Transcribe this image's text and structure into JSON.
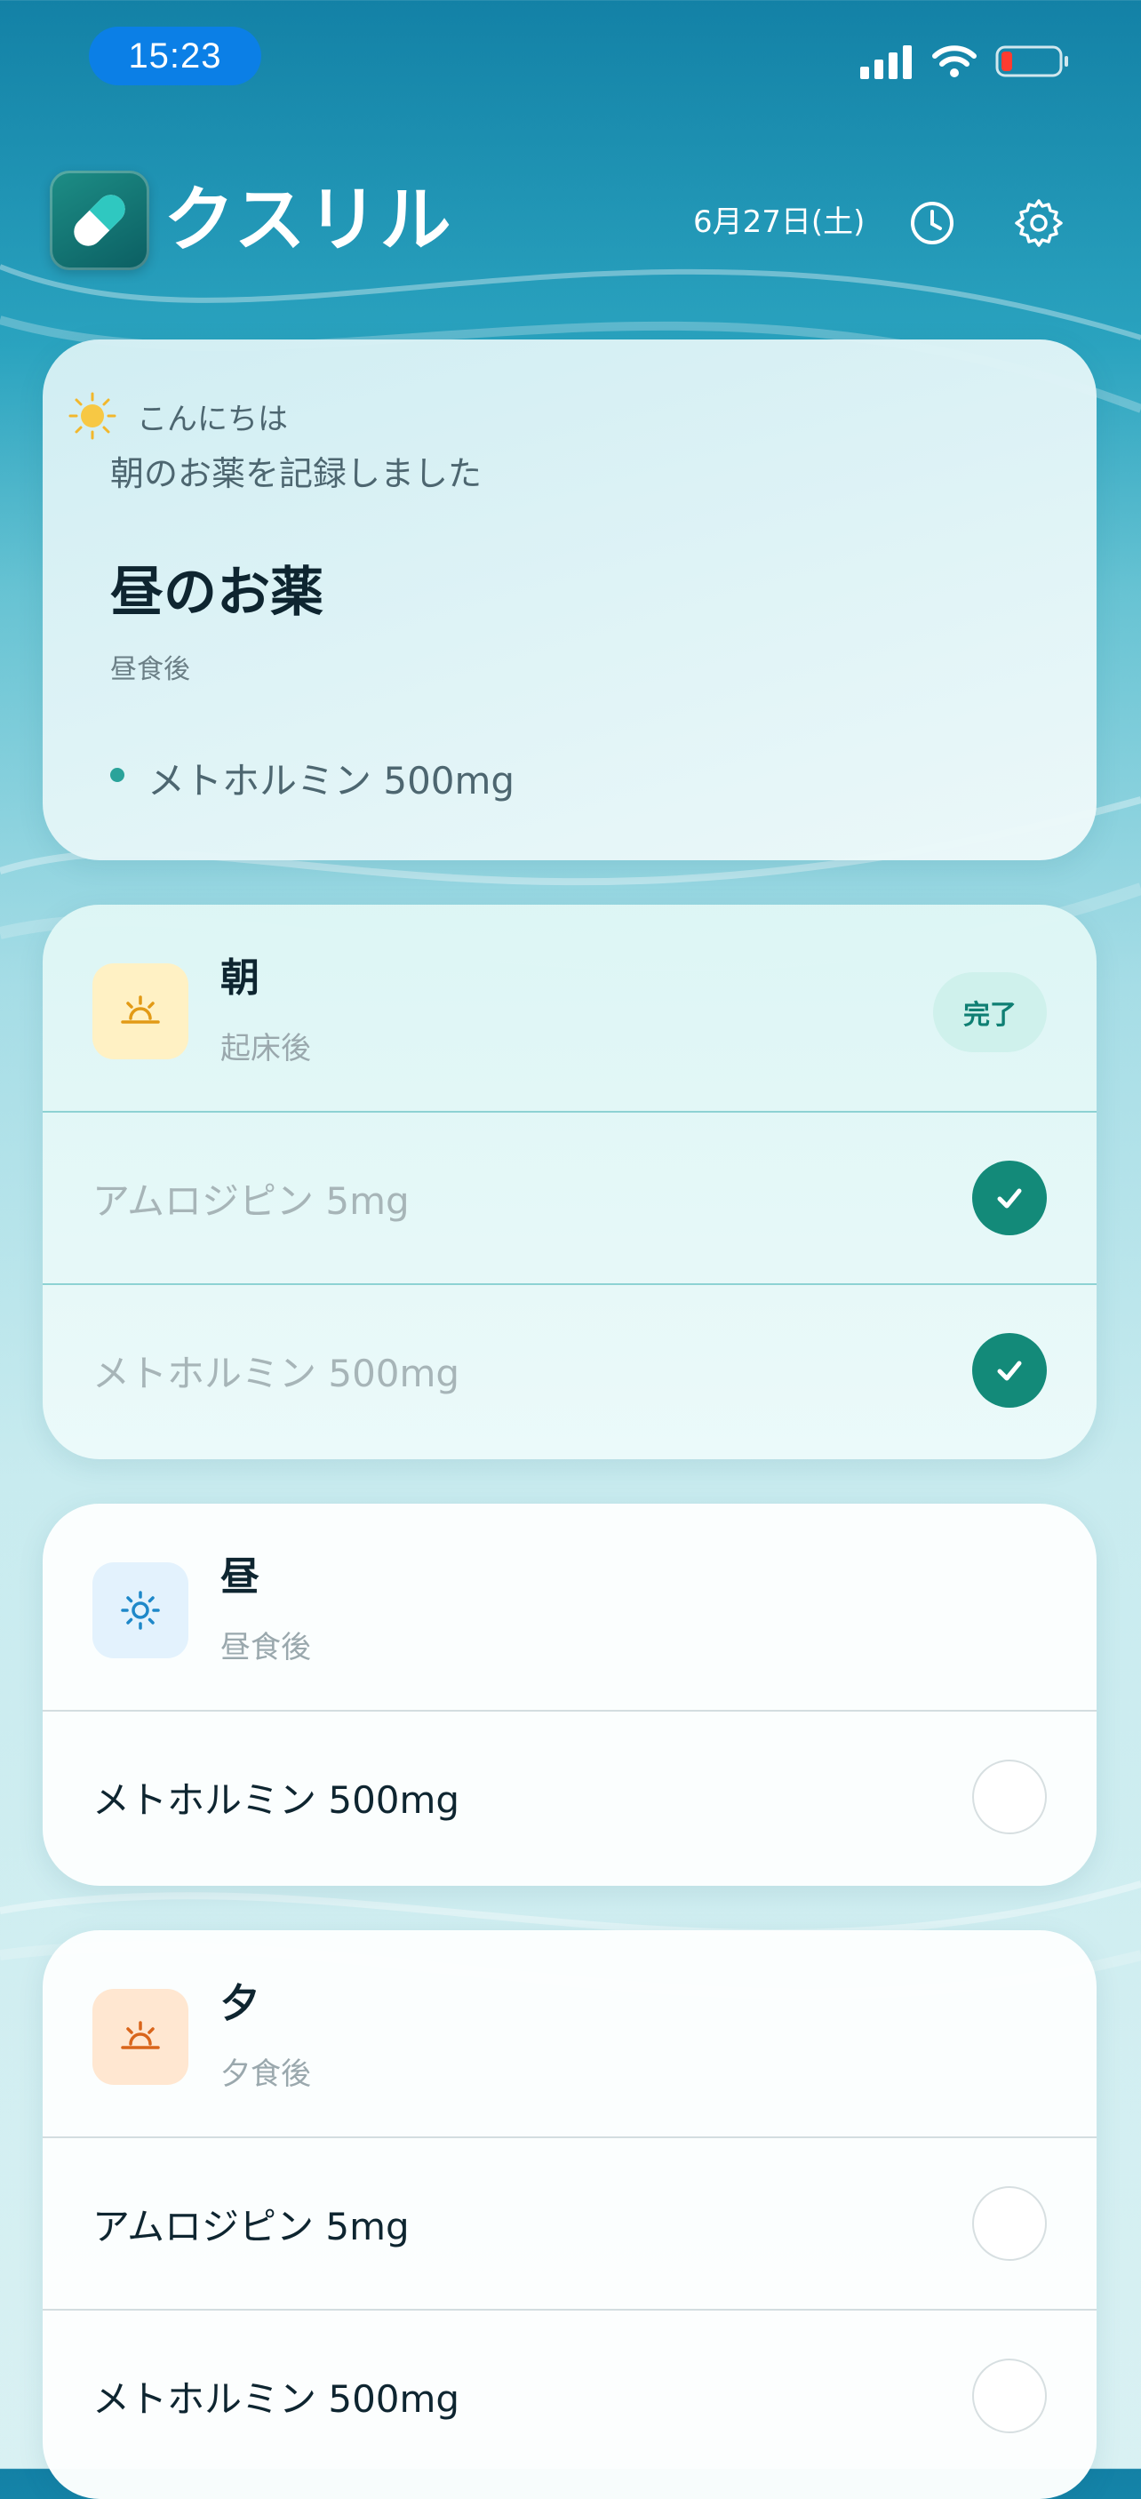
{
  "status_bar": {
    "time": "15:23"
  },
  "header": {
    "app_name": "クスリル",
    "date": "6月27日(土)",
    "icons": [
      "pill-logo-icon",
      "history-clock-icon",
      "settings-gear-icon"
    ]
  },
  "greeting": {
    "hello": "こんにちは",
    "message": "朝のお薬を記録しました",
    "next_title": "昼のお薬",
    "next_timing": "昼食後",
    "next_meds": [
      "メトホルミン 500mg"
    ]
  },
  "slots": [
    {
      "name": "朝",
      "timing": "起床後",
      "status": "完了",
      "icon": "sunrise-icon",
      "meds": [
        {
          "label": "アムロジピン 5mg",
          "taken": true
        },
        {
          "label": "メトホルミン 500mg",
          "taken": true
        }
      ]
    },
    {
      "name": "昼",
      "timing": "昼食後",
      "icon": "sun-icon",
      "meds": [
        {
          "label": "メトホルミン 500mg",
          "taken": false
        }
      ]
    },
    {
      "name": "夕",
      "timing": "夕食後",
      "icon": "sunset-icon",
      "meds": [
        {
          "label": "アムロジピン 5mg",
          "taken": false
        },
        {
          "label": "メトホルミン 500mg",
          "taken": false
        }
      ]
    }
  ],
  "colors": {
    "accent": "#138a79",
    "status_time_pill": "#0b7fe6",
    "morning_icon_bg": "#fff1c4",
    "noon_icon_bg": "#e3f2fd",
    "evening_icon_bg": "#ffe7d1"
  }
}
